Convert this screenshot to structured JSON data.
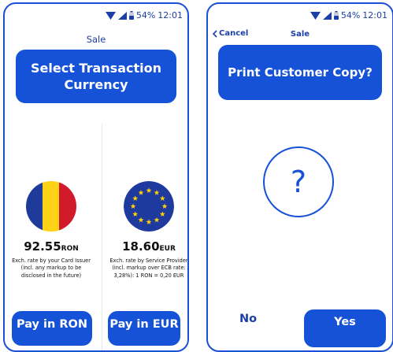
{
  "colors": {
    "accent": "#1552d8",
    "accent_text": "#1b3ea8",
    "flag_blue": "#1e3a9a",
    "flag_yellow": "#fcd116",
    "flag_red": "#d11a2a",
    "eu_blue": "#1f3a9e",
    "eu_star": "#ffd200"
  },
  "status_bar": {
    "battery": "54%",
    "time": "12:01",
    "icons": [
      "wifi-icon",
      "cell-signal-icon",
      "battery-icon"
    ]
  },
  "currency_screen": {
    "title": "Sale",
    "banner": "Select Transaction Currency",
    "options": [
      {
        "amount": "92.55",
        "currency": "RON",
        "note": "Exch. rate by your Card Issuer (incl. any markup to be disclosed in the future)",
        "button": "Pay in RON",
        "flag": "romania-flag-icon"
      },
      {
        "amount": "18.60",
        "currency": "EUR",
        "note": "Exch. rate by Service Provider (incl. markup over ECB rate: 3,28%): 1 RON = 0,20 EUR",
        "button": "Pay in EUR",
        "flag": "eu-flag-icon"
      }
    ]
  },
  "print_screen": {
    "cancel": "Cancel",
    "title": "Sale",
    "banner": "Print Customer Copy?",
    "symbol": "?",
    "no": "No",
    "yes": "Yes"
  }
}
